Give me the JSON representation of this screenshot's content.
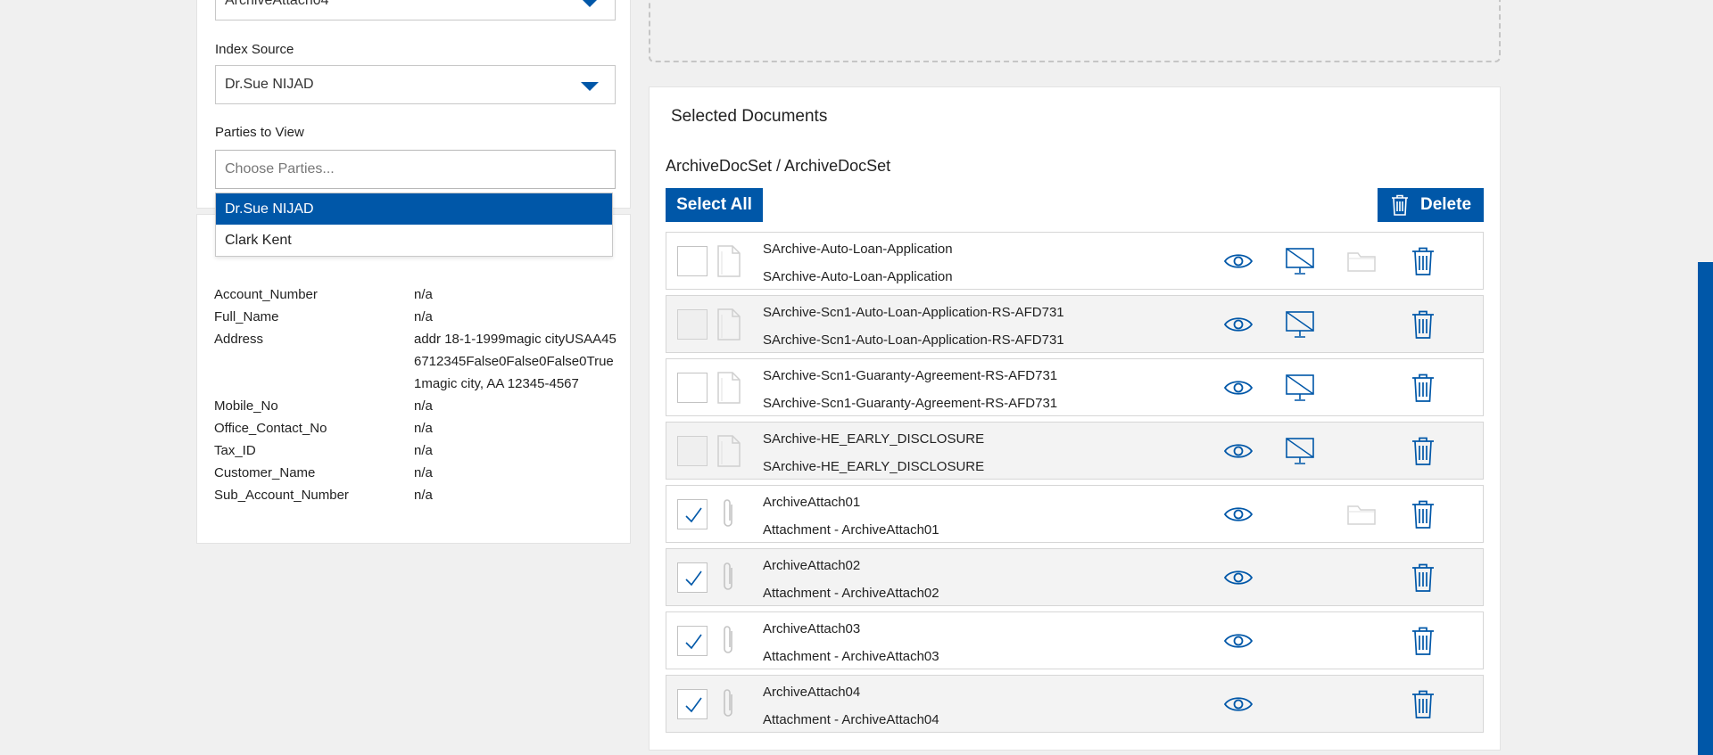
{
  "form": {
    "top_select_value": "ArchiveAttach04",
    "index_source_label": "Index Source",
    "index_source_value": "Dr.Sue NIJAD",
    "parties_label": "Parties to View",
    "parties_placeholder": "Choose Parties...",
    "parties_options": [
      "Dr.Sue NIJAD",
      "Clark Kent"
    ]
  },
  "info": [
    {
      "key": "Account_Number",
      "value": "n/a"
    },
    {
      "key": "Full_Name",
      "value": "n/a"
    },
    {
      "key": "Address",
      "value": "addr 18-1-1999magic cityUSAA456712345False0False0False0True1magic city, AA 12345-4567"
    },
    {
      "key": "Mobile_No",
      "value": "n/a"
    },
    {
      "key": "Office_Contact_No",
      "value": "n/a"
    },
    {
      "key": "Tax_ID",
      "value": "n/a"
    },
    {
      "key": "Customer_Name",
      "value": "n/a"
    },
    {
      "key": "Sub_Account_Number",
      "value": "n/a"
    }
  ],
  "selected": {
    "title": "Selected Documents",
    "path": "ArchiveDocSet / ArchiveDocSet",
    "select_all_label": "Select All",
    "delete_label": "Delete",
    "docs": [
      {
        "title": "SArchive-Auto-Loan-Application",
        "subtitle": "SArchive-Auto-Loan-Application",
        "kind": "document",
        "checked": false,
        "disabled": false,
        "monitor": true,
        "folder": true
      },
      {
        "title": "SArchive-Scn1-Auto-Loan-Application-RS-AFD731",
        "subtitle": "SArchive-Scn1-Auto-Loan-Application-RS-AFD731",
        "kind": "document",
        "checked": false,
        "disabled": true,
        "monitor": true,
        "folder": false
      },
      {
        "title": "SArchive-Scn1-Guaranty-Agreement-RS-AFD731",
        "subtitle": "SArchive-Scn1-Guaranty-Agreement-RS-AFD731",
        "kind": "document",
        "checked": false,
        "disabled": false,
        "monitor": true,
        "folder": false
      },
      {
        "title": "SArchive-HE_EARLY_DISCLOSURE",
        "subtitle": "SArchive-HE_EARLY_DISCLOSURE",
        "kind": "document",
        "checked": false,
        "disabled": true,
        "monitor": true,
        "folder": false
      },
      {
        "title": "ArchiveAttach01",
        "subtitle": "Attachment - ArchiveAttach01",
        "kind": "attachment",
        "checked": true,
        "disabled": false,
        "monitor": false,
        "folder": true
      },
      {
        "title": "ArchiveAttach02",
        "subtitle": "Attachment - ArchiveAttach02",
        "kind": "attachment",
        "checked": true,
        "disabled": false,
        "monitor": false,
        "folder": false
      },
      {
        "title": "ArchiveAttach03",
        "subtitle": "Attachment - ArchiveAttach03",
        "kind": "attachment",
        "checked": true,
        "disabled": false,
        "monitor": false,
        "folder": false
      },
      {
        "title": "ArchiveAttach04",
        "subtitle": "Attachment - ArchiveAttach04",
        "kind": "attachment",
        "checked": true,
        "disabled": false,
        "monitor": false,
        "folder": false
      }
    ]
  },
  "colors": {
    "accent": "#0057a8",
    "row_alt": "#f3f3f3"
  }
}
